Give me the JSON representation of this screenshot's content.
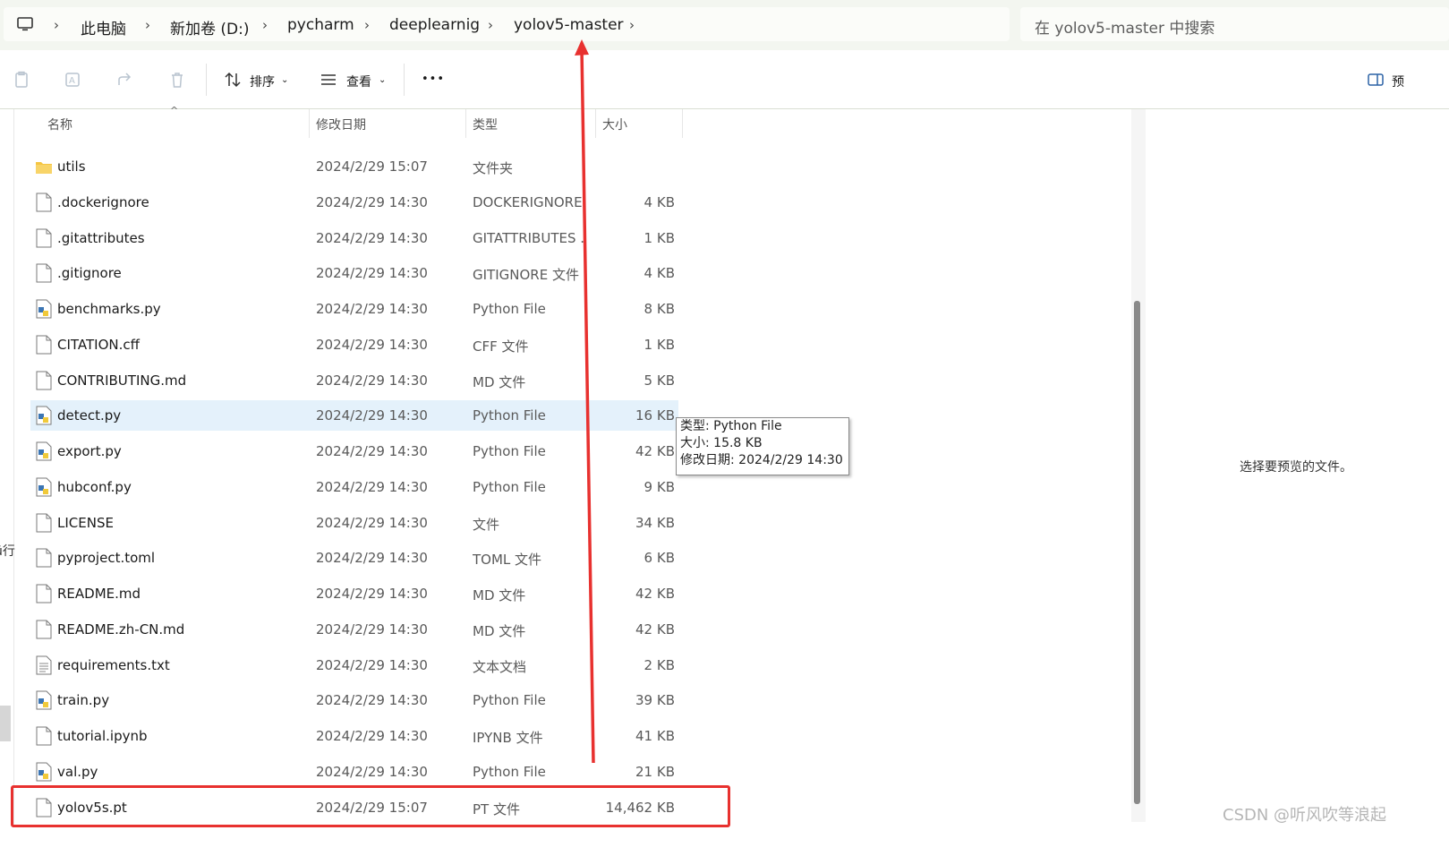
{
  "breadcrumb": {
    "items": [
      "此电脑",
      "新加卷 (D:)",
      "pycharm",
      "deeplearnig",
      "yolov5-master"
    ]
  },
  "search": {
    "placeholder": "在 yolov5-master 中搜索"
  },
  "toolbar": {
    "sort_label": "排序",
    "view_label": "查看",
    "more_label": "•••",
    "preview_label": "预"
  },
  "columns": {
    "name": "名称",
    "date": "修改日期",
    "type": "类型",
    "size": "大小"
  },
  "files": [
    {
      "name": "utils",
      "date": "2024/2/29 15:07",
      "type": "文件夹",
      "size": "",
      "icon": "folder-icon"
    },
    {
      "name": ".dockerignore",
      "date": "2024/2/29 14:30",
      "type": "DOCKERIGNORE...",
      "size": "4 KB",
      "icon": "file-icon"
    },
    {
      "name": ".gitattributes",
      "date": "2024/2/29 14:30",
      "type": "GITATTRIBUTES ...",
      "size": "1 KB",
      "icon": "file-icon"
    },
    {
      "name": ".gitignore",
      "date": "2024/2/29 14:30",
      "type": "GITIGNORE 文件",
      "size": "4 KB",
      "icon": "file-icon"
    },
    {
      "name": "benchmarks.py",
      "date": "2024/2/29 14:30",
      "type": "Python File",
      "size": "8 KB",
      "icon": "python-file-icon"
    },
    {
      "name": "CITATION.cff",
      "date": "2024/2/29 14:30",
      "type": "CFF 文件",
      "size": "1 KB",
      "icon": "file-icon"
    },
    {
      "name": "CONTRIBUTING.md",
      "date": "2024/2/29 14:30",
      "type": "MD 文件",
      "size": "5 KB",
      "icon": "file-icon"
    },
    {
      "name": "detect.py",
      "date": "2024/2/29 14:30",
      "type": "Python File",
      "size": "16 KB",
      "icon": "python-file-icon"
    },
    {
      "name": "export.py",
      "date": "2024/2/29 14:30",
      "type": "Python File",
      "size": "42 KB",
      "icon": "python-file-icon"
    },
    {
      "name": "hubconf.py",
      "date": "2024/2/29 14:30",
      "type": "Python File",
      "size": "9 KB",
      "icon": "python-file-icon"
    },
    {
      "name": "LICENSE",
      "date": "2024/2/29 14:30",
      "type": "文件",
      "size": "34 KB",
      "icon": "file-icon"
    },
    {
      "name": "pyproject.toml",
      "date": "2024/2/29 14:30",
      "type": "TOML 文件",
      "size": "6 KB",
      "icon": "file-icon"
    },
    {
      "name": "README.md",
      "date": "2024/2/29 14:30",
      "type": "MD 文件",
      "size": "42 KB",
      "icon": "file-icon"
    },
    {
      "name": "README.zh-CN.md",
      "date": "2024/2/29 14:30",
      "type": "MD 文件",
      "size": "42 KB",
      "icon": "file-icon"
    },
    {
      "name": "requirements.txt",
      "date": "2024/2/29 14:30",
      "type": "文本文档",
      "size": "2 KB",
      "icon": "text-file-icon"
    },
    {
      "name": "train.py",
      "date": "2024/2/29 14:30",
      "type": "Python File",
      "size": "39 KB",
      "icon": "python-file-icon"
    },
    {
      "name": "tutorial.ipynb",
      "date": "2024/2/29 14:30",
      "type": "IPYNB 文件",
      "size": "41 KB",
      "icon": "file-icon"
    },
    {
      "name": "val.py",
      "date": "2024/2/29 14:30",
      "type": "Python File",
      "size": "21 KB",
      "icon": "python-file-icon"
    },
    {
      "name": "yolov5s.pt",
      "date": "2024/2/29 15:07",
      "type": "PT 文件",
      "size": "14,462 KB",
      "icon": "file-icon"
    }
  ],
  "selected_index": 7,
  "highlighted_index": 18,
  "tooltip": {
    "line1": "类型: Python File",
    "line2": "大小: 15.8 KB",
    "line3": "修改日期: 2024/2/29 14:30"
  },
  "preview": {
    "empty_text": "选择要预览的文件。"
  },
  "left_fragment": "ǜ行",
  "watermark": "CSDN @听风吹等浪起",
  "colors": {
    "annotation_red": "#e8312f",
    "selection": "#e4f1fb",
    "folder": "#f5c542"
  }
}
